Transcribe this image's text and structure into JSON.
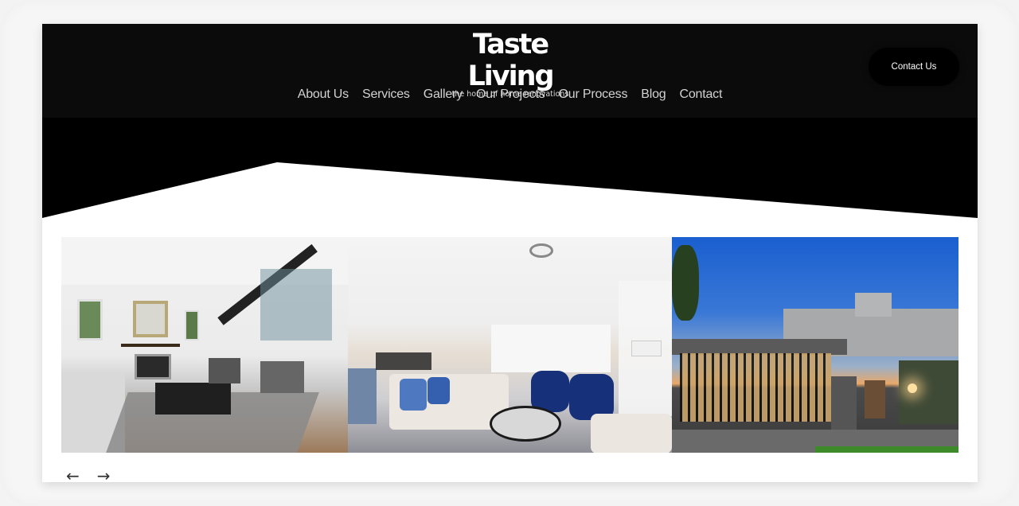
{
  "brand": {
    "name": "Taste Living",
    "tagline": "the home of home renovations"
  },
  "nav": {
    "items": [
      {
        "label": "About Us"
      },
      {
        "label": "Services"
      },
      {
        "label": "Gallery"
      },
      {
        "label": "Our Projects"
      },
      {
        "label": "Our Process"
      },
      {
        "label": "Blog"
      },
      {
        "label": "Contact"
      }
    ]
  },
  "header": {
    "contact_button": "Contact Us"
  },
  "gallery": {
    "photos": [
      {
        "alt": "Living room with fireplace and floating staircase"
      },
      {
        "alt": "Open plan living room with blue armchairs"
      },
      {
        "alt": "Modern house exterior at dusk with gate"
      }
    ],
    "prev_icon": "←",
    "next_icon": "→"
  },
  "colors": {
    "header_bg": "#0b0b0b",
    "page_bg": "#ffffff",
    "nav_text": "#d2d2d2"
  }
}
